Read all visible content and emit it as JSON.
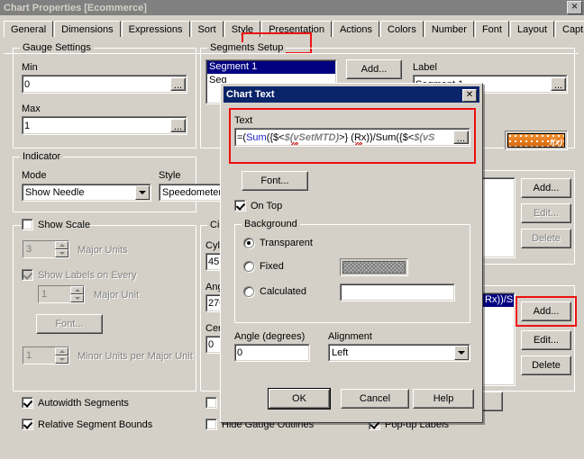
{
  "window": {
    "title": "Chart Properties [Ecommerce]",
    "close_label": "✕"
  },
  "tabs": [
    {
      "label": "General"
    },
    {
      "label": "Dimensions"
    },
    {
      "label": "Expressions"
    },
    {
      "label": "Sort"
    },
    {
      "label": "Style"
    },
    {
      "label": "Presentation"
    },
    {
      "label": "Actions"
    },
    {
      "label": "Colors"
    },
    {
      "label": "Number"
    },
    {
      "label": "Font"
    },
    {
      "label": "Layout"
    },
    {
      "label": "Caption"
    }
  ],
  "selected_tab": "Presentation",
  "gauge_settings": {
    "title": "Gauge Settings",
    "min_label": "Min",
    "min_value": "0",
    "max_label": "Max",
    "max_value": "1",
    "ellipsis": "..."
  },
  "indicator": {
    "title": "Indicator",
    "mode_label": "Mode",
    "mode_value": "Show Needle",
    "style_label": "Style",
    "style_value": "Speedometer"
  },
  "show_scale": {
    "title": "Show Scale",
    "checked": false,
    "major_units_value": "3",
    "major_units_label": "Major Units",
    "show_labels_label": "Show Labels on Every",
    "show_labels_checked": true,
    "major_unit_value": "1",
    "major_unit_label": "Major Unit",
    "font_button": "Font...",
    "minor_units_value": "1",
    "minor_units_label": "Minor Units per Major Unit"
  },
  "circumference": {
    "title": "Circu",
    "cylinder_label": "Cylin",
    "cylinder_value": "45",
    "angle_label": "Angl",
    "angle_value": "270",
    "center_label": "Cent",
    "center_value": "0"
  },
  "segments_setup": {
    "title": "Segments Setup",
    "items": [
      {
        "label": "Segment 1",
        "selected": true
      },
      {
        "label": "Seg",
        "selected": false
      }
    ],
    "add_button": "Add...",
    "label_label": "Label",
    "label_value": "Segment 1",
    "label_ellipsis": "...",
    "swatch_fx": "f(x)"
  },
  "right_group_a": {
    "add_button": "Add...",
    "edit_button": "Edit...",
    "delete_button": "Delete"
  },
  "right_group_b": {
    "list_text": "Rx))/S",
    "add_button": "Add...",
    "edit_button": "Edit...",
    "delete_button": "Delete"
  },
  "bottom_checks": {
    "autowidth": {
      "label": "Autowidth Segments",
      "checked": true
    },
    "relative": {
      "label": "Relative Segment Bounds",
      "checked": true
    },
    "hidden_partial": {
      "label": "H",
      "checked": false
    },
    "hide_gauge_outlines": {
      "label": "Hide Gauge Outlines",
      "checked": false
    },
    "popup_labels": {
      "label": "Pop-up Labels",
      "checked": true
    }
  },
  "main_buttons": {
    "ok": "OK",
    "cancel": "Cancel",
    "help": "Help"
  },
  "dialog": {
    "title": "Chart Text",
    "close_label": "✕",
    "text_label": "Text",
    "text_segments": [
      {
        "t": "=(",
        "c": "plain"
      },
      {
        "t": "Sum",
        "c": "fn"
      },
      {
        "t": "({$<",
        "c": "plain"
      },
      {
        "t": "$(vSetMTD)",
        "c": "var"
      },
      {
        "t": ">} (Rx))/",
        "c": "plain"
      },
      {
        "t": "Sum",
        "c": "plain"
      },
      {
        "t": "({$<",
        "c": "plain"
      },
      {
        "t": "$(vS",
        "c": "var"
      }
    ],
    "text_value": "=(Sum({$<$(vSetMTD)>} (Rx))/Sum({$<$(vS",
    "text_ellipsis": "...",
    "font_button": "Font...",
    "on_top": {
      "label": "On Top",
      "checked": true
    },
    "background": {
      "title": "Background",
      "transparent": "Transparent",
      "fixed": "Fixed",
      "calculated": "Calculated",
      "selected": "Transparent",
      "calculated_value": ""
    },
    "angle_label": "Angle (degrees)",
    "angle_value": "0",
    "alignment_label": "Alignment",
    "alignment_value": "Left",
    "ok": "OK",
    "cancel": "Cancel",
    "help": "Help"
  },
  "colors": {
    "accent_red": "#ee1111",
    "title_blue": "#0a246a",
    "selection_blue": "#000080",
    "face": "#d4d0c8",
    "swatch_orange": "#e2761a"
  }
}
